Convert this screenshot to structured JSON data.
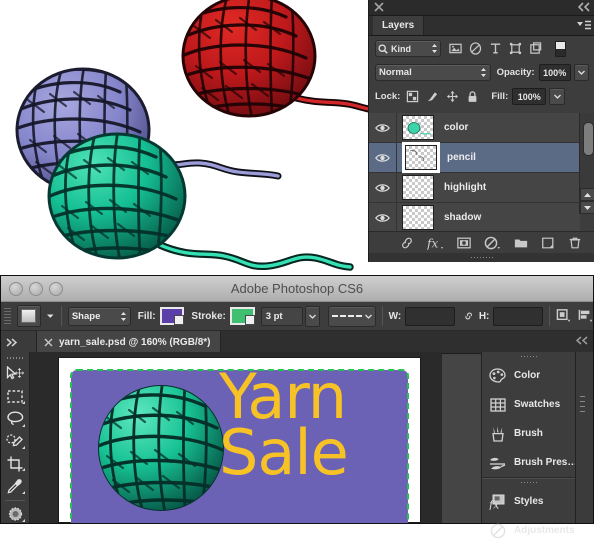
{
  "illustration": {
    "name": "yarn-balls-illustration",
    "description": "Three balls of yarn with trailing threads",
    "balls": [
      {
        "color_name": "periwinkle",
        "fill": "#8c8cd0",
        "shade": "#5b5b96",
        "has_thread": true
      },
      {
        "color_name": "red",
        "fill": "#c0181c",
        "shade": "#7c0f12",
        "has_thread": true
      },
      {
        "color_name": "teal",
        "fill": "#19c49a",
        "shade": "#0c7a60",
        "has_thread": true
      }
    ]
  },
  "layers_panel": {
    "close_icon": "close-icon",
    "collapse_icon": "collapse-double-arrow-icon",
    "tab_label": "Layers",
    "menu_icon": "panel-menu-icon",
    "filter": {
      "search_icon": "search-icon",
      "kind_label": "Kind",
      "stepper_icon": "stepper-arrows-icon",
      "icons": [
        "pixel-layer-filter-icon",
        "adjustment-layer-filter-icon",
        "type-layer-filter-icon",
        "shape-layer-filter-icon",
        "smart-object-filter-icon"
      ],
      "toggle_icon": "filter-toggle-icon"
    },
    "blend": {
      "mode": "Normal",
      "opacity_label": "Opacity:",
      "opacity_value": "100%",
      "opacity_dropdown_icon": "chevron-down-icon"
    },
    "lock": {
      "label": "Lock:",
      "icons": [
        "lock-transparent-pixels-icon",
        "lock-image-pixels-icon",
        "lock-position-icon",
        "lock-all-icon"
      ],
      "fill_label": "Fill:",
      "fill_value": "100%",
      "fill_dropdown_icon": "chevron-down-icon"
    },
    "layers": [
      {
        "name": "color",
        "visible": true,
        "selected": false,
        "thumb": "teal-yarn-thumbnail"
      },
      {
        "name": "pencil",
        "visible": true,
        "selected": true,
        "thumb": "pencil-sketch-thumbnail"
      },
      {
        "name": "highlight",
        "visible": true,
        "selected": false,
        "thumb": "empty-transparent-thumbnail"
      },
      {
        "name": "shadow",
        "visible": true,
        "selected": false,
        "thumb": "empty-transparent-thumbnail"
      }
    ],
    "scrollbar": {
      "up_icon": "scroll-up-arrow-icon",
      "down_icon": "scroll-down-arrow-icon"
    },
    "bottom_icons": [
      "link-layers-icon",
      "layer-style-fx-icon",
      "add-layer-mask-icon",
      "new-fill-adjustment-layer-icon",
      "new-group-icon",
      "new-layer-icon",
      "delete-layer-icon"
    ],
    "colors": {
      "selected_row": "#5b6b86",
      "panel_bg": "#3d3d3d",
      "row_bg": "#454545"
    }
  },
  "photoshop": {
    "window_title": "Adobe Photoshop CS6",
    "traffic_lights": [
      "close-button",
      "minimize-button",
      "zoom-button"
    ],
    "options_bar": {
      "grip_icon": "drag-grip-icon",
      "tool_preset_icon": "tool-preset-picker-icon",
      "tool_preset_dropdown_icon": "chevron-down-icon",
      "mode_value": "Shape",
      "mode_stepper_icon": "stepper-arrows-icon",
      "fill_label": "Fill:",
      "fill_color": "#5b3fa8",
      "stroke_label": "Stroke:",
      "stroke_color": "#3fbf72",
      "stroke_width": "3 pt",
      "stroke_width_dropdown_icon": "chevron-down-icon",
      "stroke_style_icon": "dashed-line-style-icon",
      "w_label": "W:",
      "w_value": "",
      "link_icon": "link-wh-icon",
      "h_label": "H:",
      "h_value": "",
      "path_ops_icon": "path-operations-icon",
      "path_align_icon": "path-alignment-icon"
    },
    "tab_bar": {
      "left_expand_icon": "expand-panels-icon",
      "document_tab": {
        "close_icon": "close-tab-icon",
        "title": "yarn_sale.psd @ 160% (RGB/8*)"
      },
      "right_collapse_icon": "collapse-double-arrow-icon"
    },
    "tools": [
      "move-tool-icon",
      "rectangular-marquee-tool-icon",
      "lasso-tool-icon",
      "quick-selection-tool-icon",
      "crop-tool-icon",
      "eyedropper-tool-icon",
      "spot-healing-brush-tool-icon"
    ],
    "canvas": {
      "document_name": "yarn_sale.psd",
      "zoom": "160%",
      "color_mode": "RGB/8*",
      "artboard_fill": "#6b62b5",
      "selection_color": "#28c153",
      "headline_line1": "Yarn",
      "headline_line2": "Sale",
      "headline_color": "#f6c226",
      "yarn_ball_color": "#19c49a"
    },
    "right_panel": {
      "grip_icon": "drag-grip-icon",
      "groups": [
        {
          "items": [
            {
              "label": "Color",
              "icon": "color-palette-icon"
            },
            {
              "label": "Swatches",
              "icon": "swatches-grid-icon"
            },
            {
              "label": "Brush",
              "icon": "brush-cup-icon"
            },
            {
              "label": "Brush Pres…",
              "icon": "brush-presets-icon"
            }
          ]
        },
        {
          "items": [
            {
              "label": "Styles",
              "icon": "styles-fx-icon"
            },
            {
              "label": "Adjustments",
              "icon": "adjustments-circle-icon"
            }
          ]
        }
      ]
    }
  }
}
